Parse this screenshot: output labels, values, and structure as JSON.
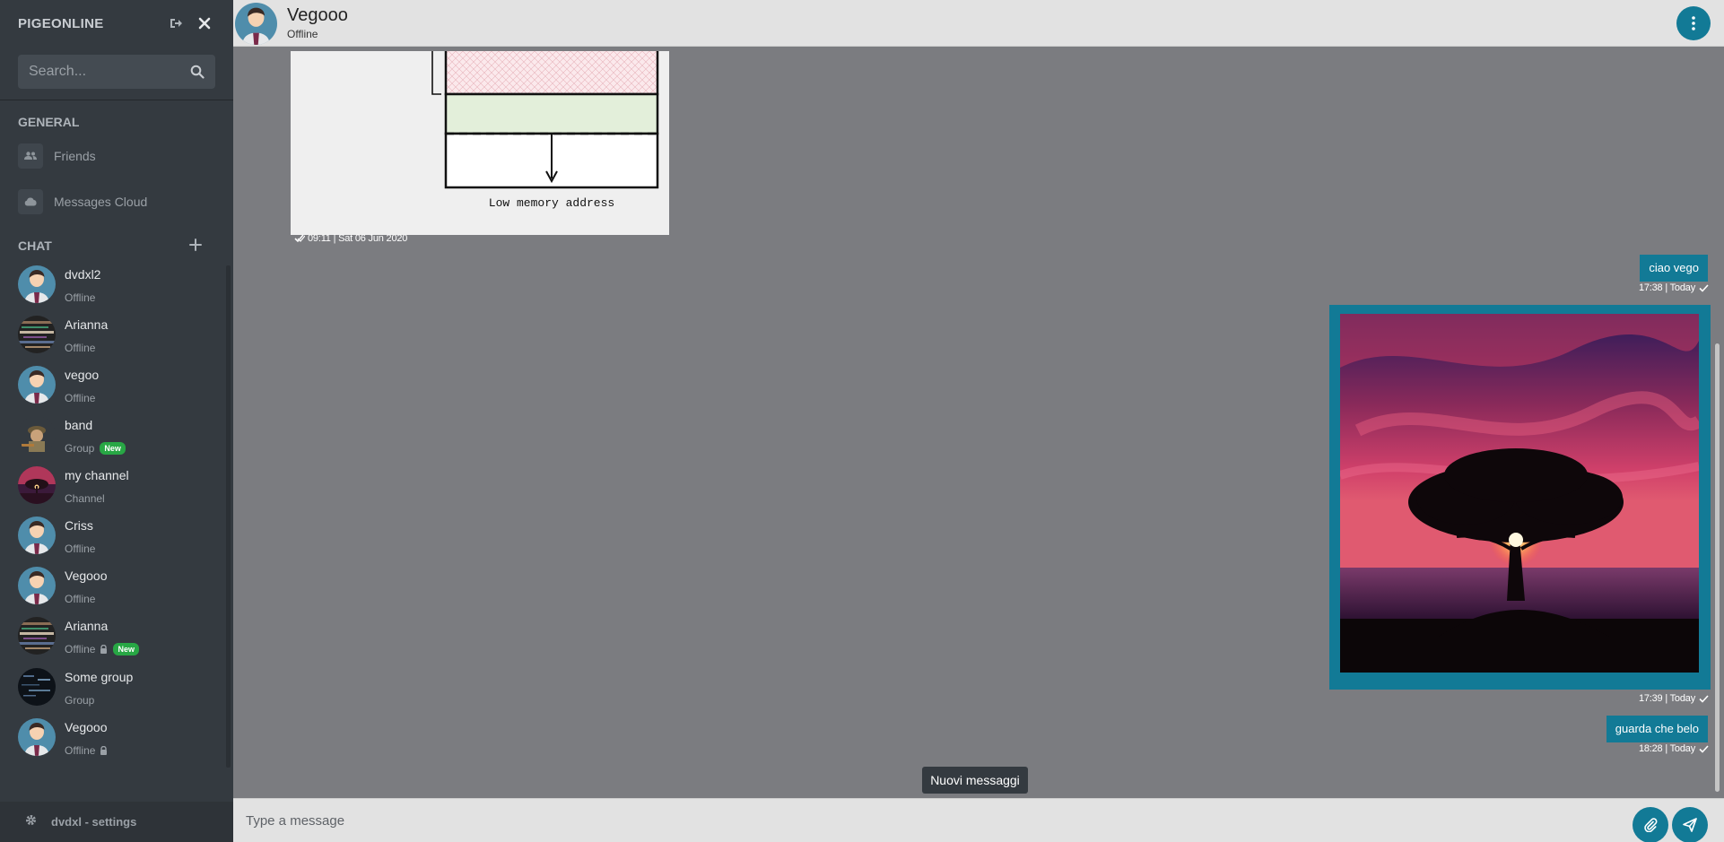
{
  "app": {
    "brand": "PIGEONLINE",
    "search_placeholder": "Search...",
    "accent_color": "#127a96",
    "sidebar_color": "#343a40"
  },
  "sidebar": {
    "general_title": "GENERAL",
    "general_items": [
      {
        "label": "Friends",
        "icon": "friends-icon"
      },
      {
        "label": "Messages Cloud",
        "icon": "cloud-icon"
      }
    ],
    "chat_title": "CHAT",
    "chats": [
      {
        "name": "dvdxl2",
        "status": "Offline",
        "avatar": "person-avatar"
      },
      {
        "name": "Arianna",
        "status": "Offline",
        "avatar": "pattern-avatar"
      },
      {
        "name": "vegoo",
        "status": "Offline",
        "avatar": "person-avatar"
      },
      {
        "name": "band",
        "status": "Group",
        "badge": "New",
        "avatar": "band-avatar"
      },
      {
        "name": "my channel",
        "status": "Channel",
        "avatar": "sunset-avatar"
      },
      {
        "name": "Criss",
        "status": "Offline",
        "avatar": "person-avatar"
      },
      {
        "name": "Vegooo",
        "status": "Offline",
        "avatar": "person-avatar"
      },
      {
        "name": "Arianna",
        "status": "Offline",
        "locked": true,
        "badge": "New",
        "avatar": "pattern-avatar"
      },
      {
        "name": "Some group",
        "status": "Group",
        "avatar": "dark-avatar"
      },
      {
        "name": "Vegooo",
        "status": "Offline",
        "locked": true,
        "avatar": "person-avatar"
      }
    ],
    "settings_label": "dvdxl - settings"
  },
  "header": {
    "name": "Vegooo",
    "status": "Offline"
  },
  "messages": [
    {
      "type": "image",
      "direction": "in",
      "caption": "Low memory address",
      "time": "09:11 | Sat 06 Jun 2020"
    },
    {
      "type": "text",
      "direction": "out",
      "text": "ciao vego",
      "time": "17:38 | Today"
    },
    {
      "type": "image",
      "direction": "out",
      "subject": "tree at sunset",
      "time": "17:39 | Today"
    },
    {
      "type": "text",
      "direction": "out",
      "text": "guarda che belo",
      "time": "18:28 | Today"
    }
  ],
  "new_messages_label": "Nuovi messaggi",
  "composer": {
    "placeholder": "Type a message"
  }
}
